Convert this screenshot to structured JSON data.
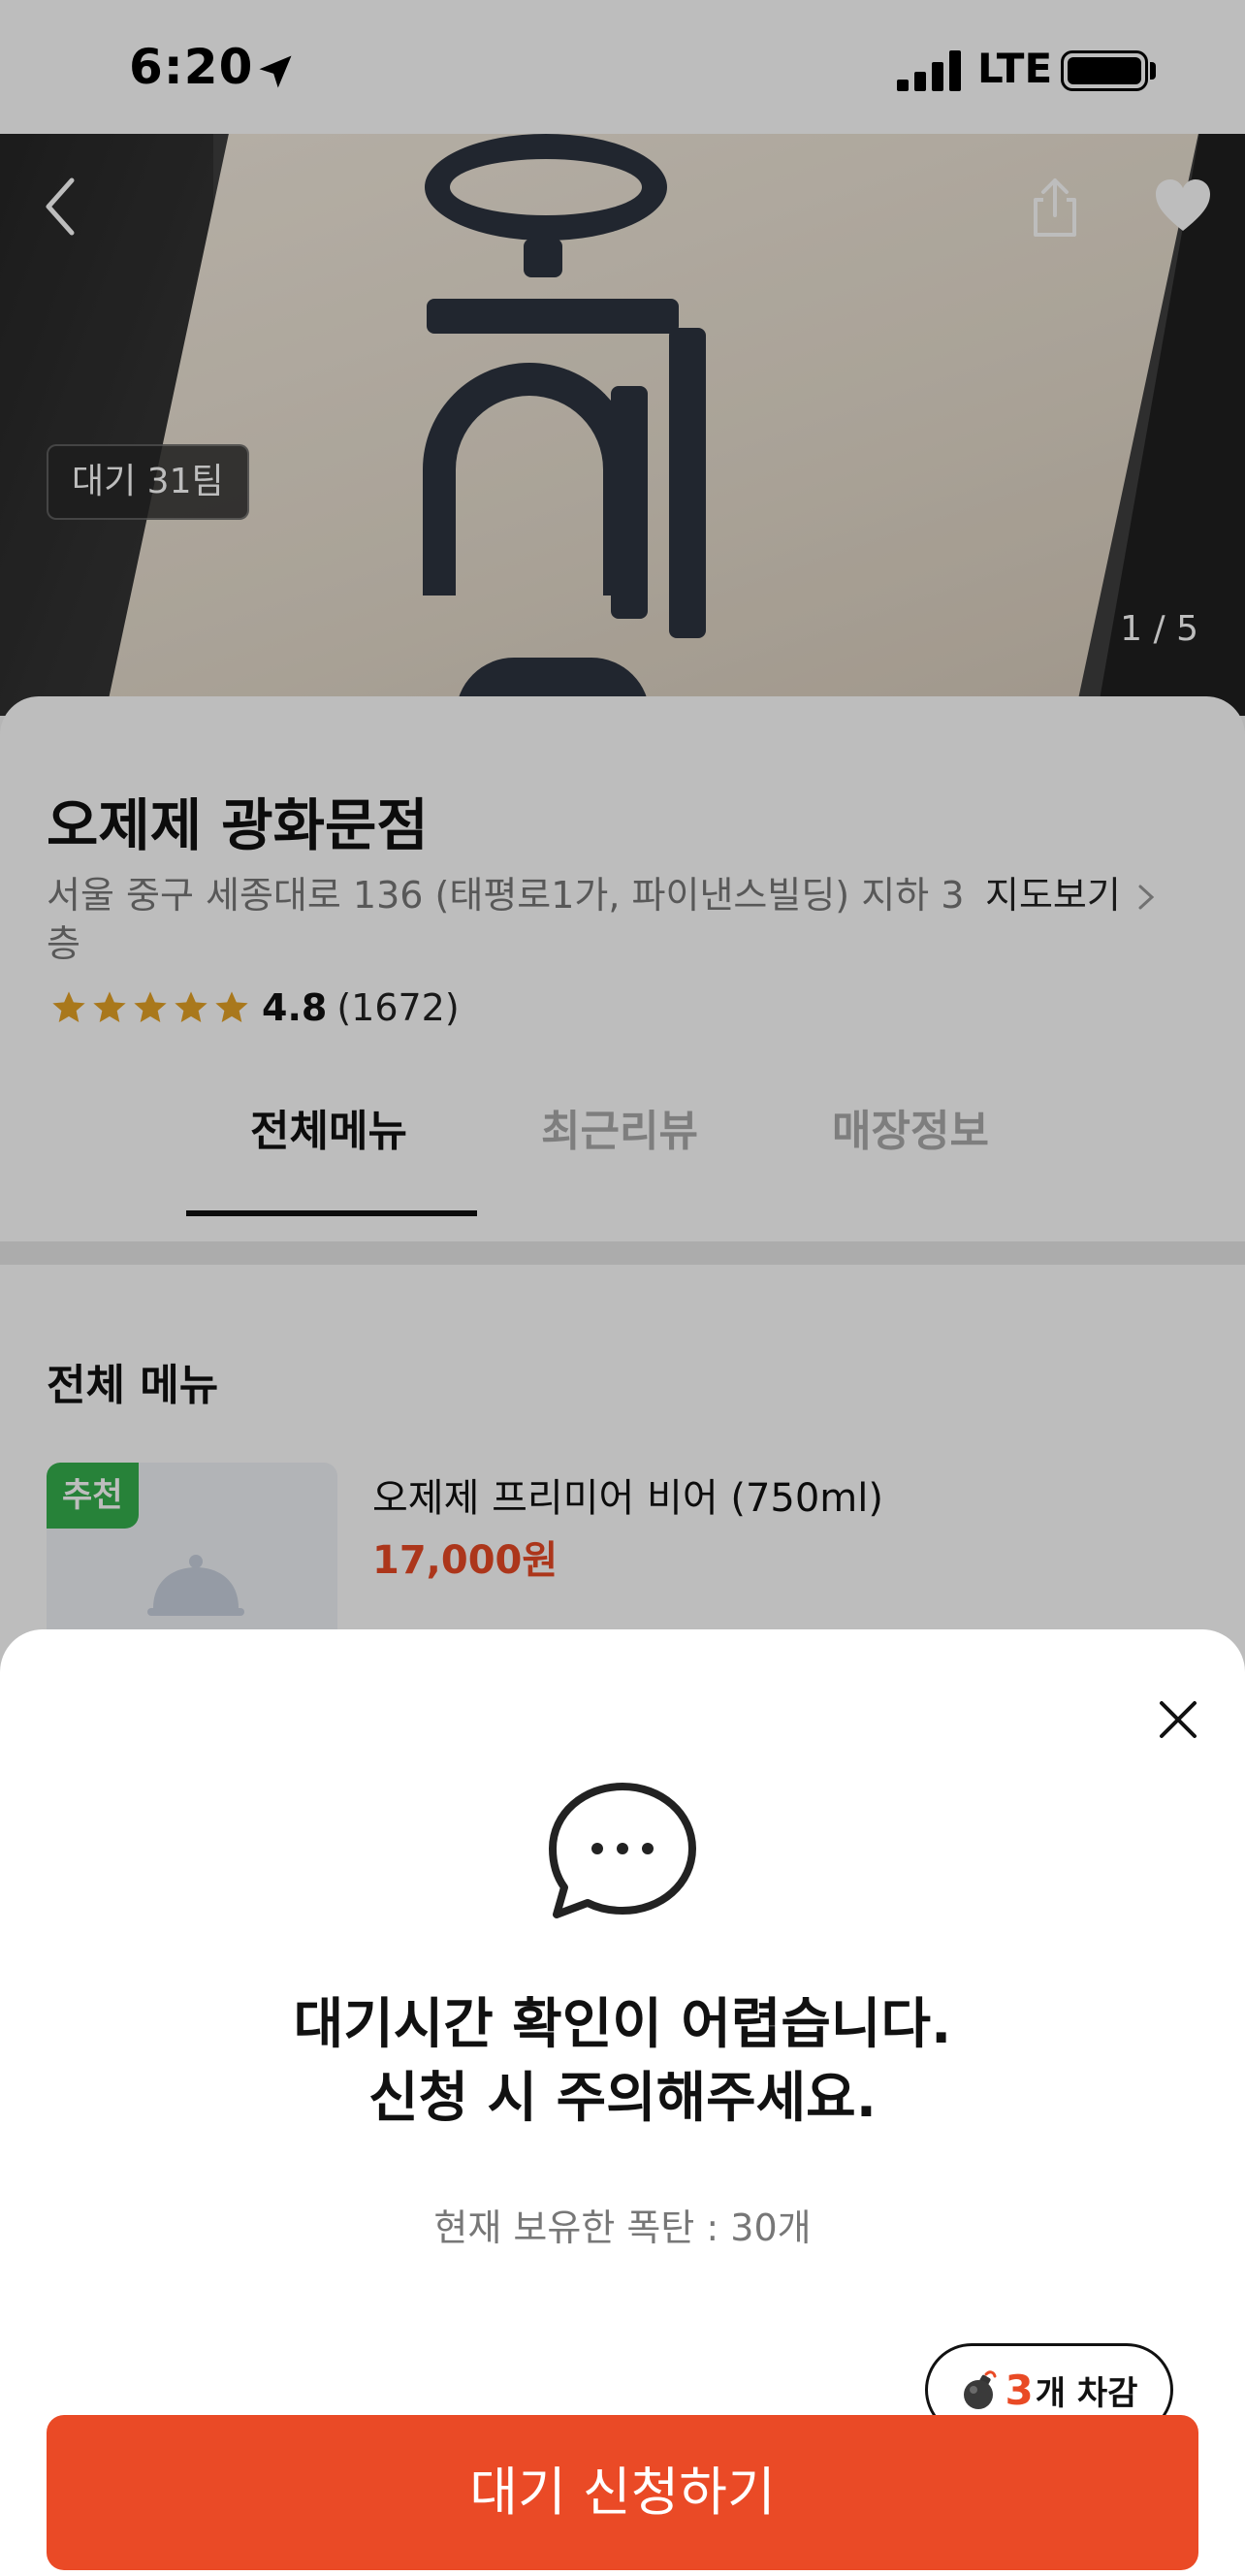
{
  "status_bar": {
    "time": "6:20",
    "network": "LTE",
    "location_icon": "location-arrow-icon",
    "signal_icon": "cellular-signal-icon",
    "battery_icon": "battery-icon"
  },
  "hero": {
    "wait_badge": "대기 31팀",
    "photo_counter": "1 / 5",
    "back_icon": "chevron-left-icon",
    "share_icon": "share-icon",
    "favorite_icon": "heart-icon"
  },
  "store": {
    "name": "오제제 광화문점",
    "address": "서울 중구 세종대로 136 (태평로1가, 파이낸스빌딩) 지하 3층",
    "map_link": "지도보기",
    "rating": "4.8",
    "review_count": "(1672)",
    "star_color": "#E5A227"
  },
  "tabs": [
    {
      "label": "전체메뉴",
      "active": true
    },
    {
      "label": "최근리뷰",
      "active": false
    },
    {
      "label": "매장정보",
      "active": false
    }
  ],
  "menu": {
    "section_title": "전체 메뉴",
    "items": [
      {
        "badge": "추천",
        "name": "오제제 프리미어 비어 (750ml)",
        "price": "17,000원"
      }
    ]
  },
  "sheet": {
    "title_line1": "대기시간 확인이 어렵습니다.",
    "title_line2": "신청 시 주의해주세요.",
    "bomb_balance": "현재 보유한 폭탄 : 30개",
    "tooltip_count": "3",
    "tooltip_text": "개 차감",
    "cta_label": "대기 신청하기",
    "accent_color": "#EA4A26"
  }
}
